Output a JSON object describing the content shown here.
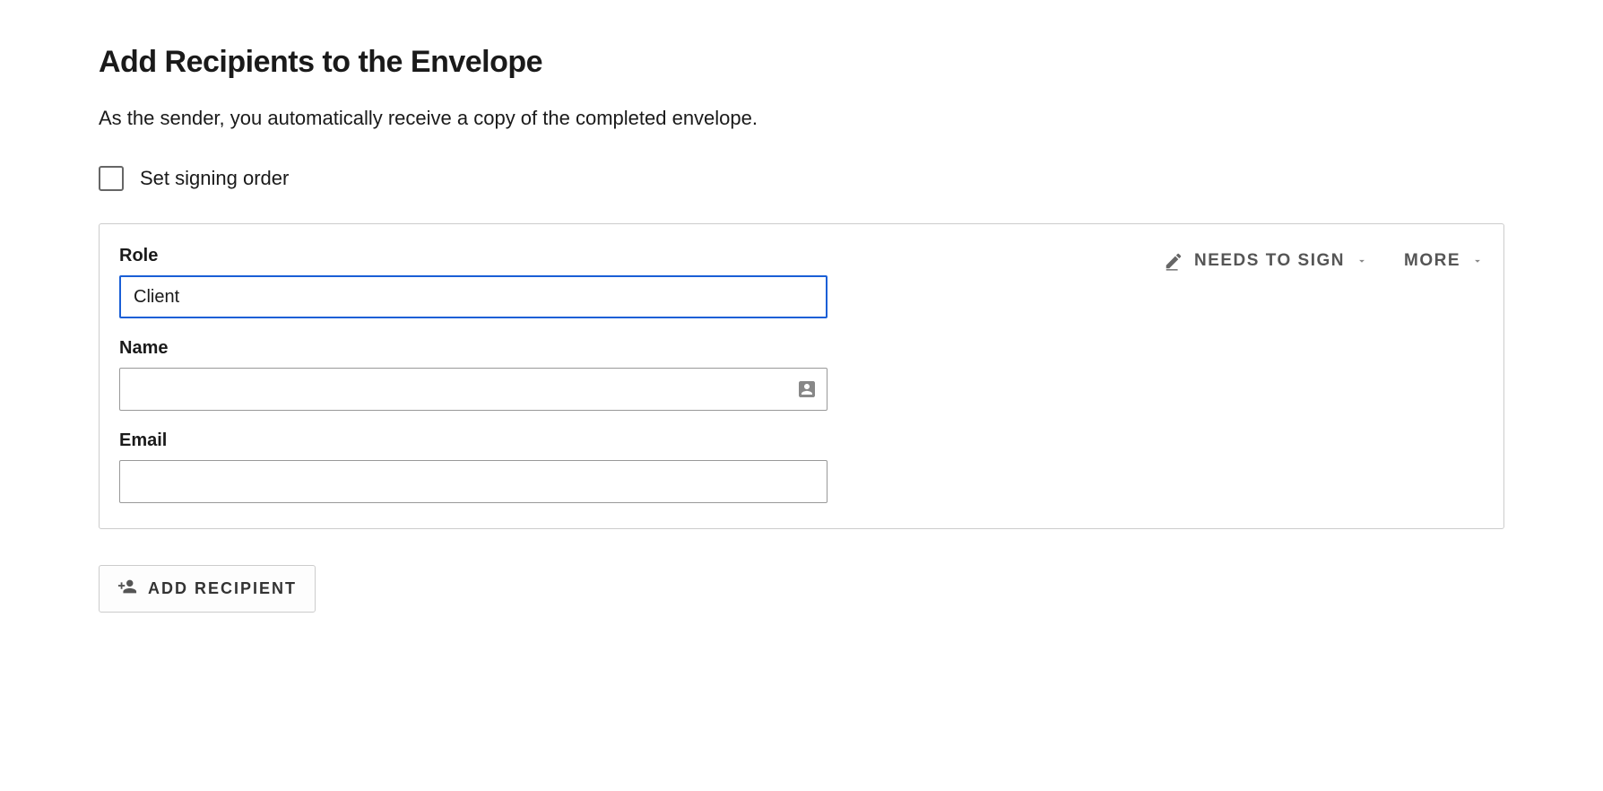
{
  "header": {
    "title": "Add Recipients to the Envelope",
    "subtitle": "As the sender, you automatically receive a copy of the completed envelope."
  },
  "signing_order": {
    "label": "Set signing order",
    "checked": false
  },
  "recipient": {
    "role": {
      "label": "Role",
      "value": "Client"
    },
    "name": {
      "label": "Name",
      "value": ""
    },
    "email": {
      "label": "Email",
      "value": ""
    },
    "actions": {
      "needs_to_sign": "NEEDS TO SIGN",
      "more": "MORE"
    }
  },
  "add_recipient_button": "ADD RECIPIENT"
}
